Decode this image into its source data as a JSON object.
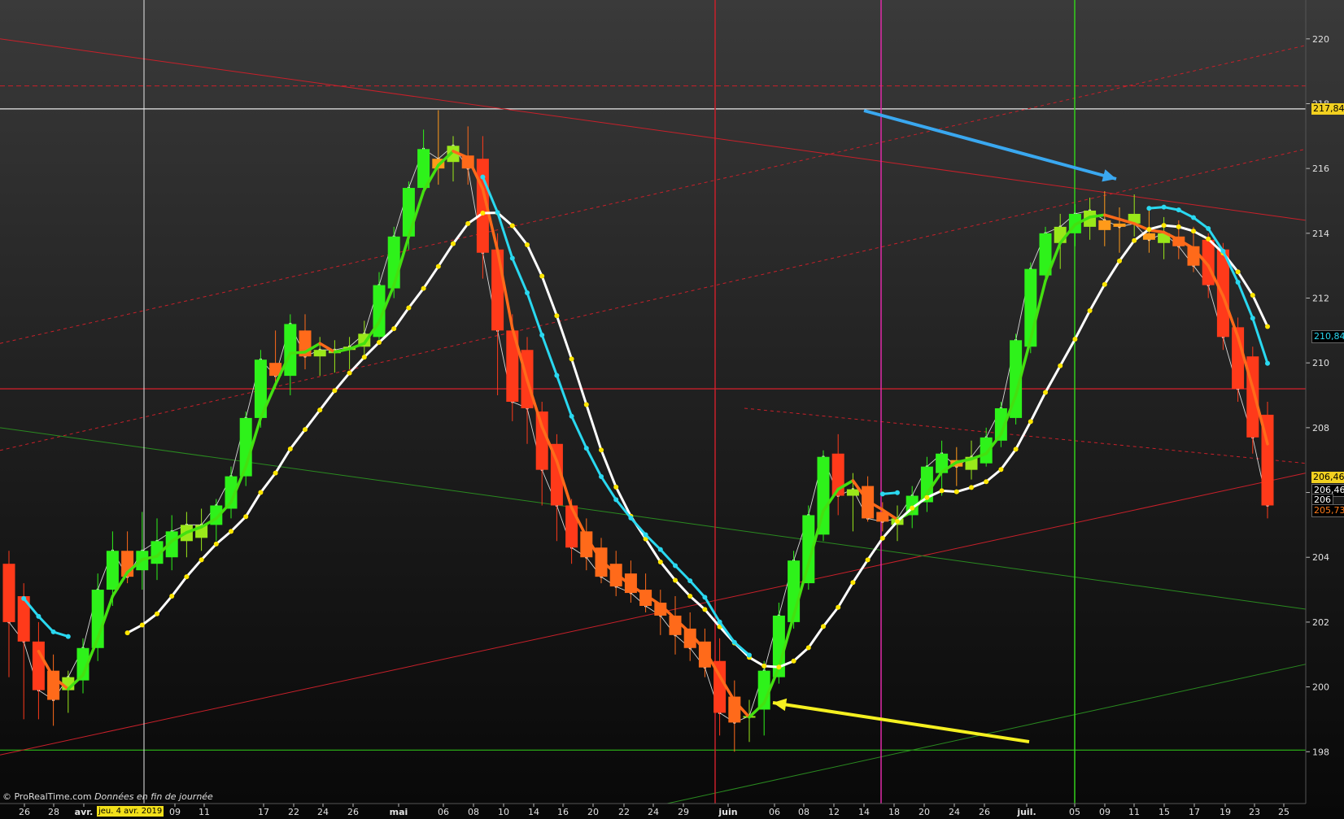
{
  "app": {
    "credit": "© ProRealTime.com",
    "credit_note": "Données en fin de journée",
    "cursor_date": "jeu. 4 avr. 2019"
  },
  "colors": {
    "bull": "#2ef21a",
    "bear": "#ff3a1a",
    "hull_line": "#44e010",
    "sma_line": "#ffffff",
    "sma_points": "#ffe600",
    "ema_line": "#2ad8f0",
    "close_line": "#d8d8d8",
    "cursor_line": "#e8e8e8",
    "red_line": "#c8202a",
    "magenta_line": "#e02aa8",
    "green_line": "#32d01a",
    "arrow_blue": "#3aa8f0",
    "arrow_yellow": "#f5f020"
  },
  "price_labels": [
    {
      "text": "217,84",
      "bg": "#f2d020",
      "fg": "#000000",
      "price": 217.84
    },
    {
      "text": "210,84",
      "bg": "#000000",
      "fg": "#2ad8f0",
      "price": 210.84
    },
    {
      "text": "206,46",
      "bg": "#f2d020",
      "fg": "#000000",
      "price": 206.46
    },
    {
      "text": "206,46",
      "bg": "#000000",
      "fg": "#ffffff",
      "price": 206.1
    },
    {
      "text": "206",
      "bg": "#000000",
      "fg": "#ffffff",
      "price": 205.78
    },
    {
      "text": "205,73",
      "bg": "#000000",
      "fg": "#ff7a1a",
      "price": 205.46
    }
  ],
  "chart_data": {
    "type": "candlestick",
    "y_range": [
      196.4,
      221.2
    ],
    "y_ticks": [
      "198",
      "200",
      "202",
      "204",
      "206",
      "208",
      "210",
      "212",
      "214",
      "216",
      "218",
      "220"
    ],
    "y_tick_values": [
      198,
      200,
      202,
      204,
      206,
      208,
      210,
      212,
      214,
      216,
      218,
      220
    ],
    "x_ticks": [
      "26",
      "28",
      "avr.",
      "jeu. 4 avr. 2019",
      "09",
      "11",
      "17",
      "22",
      "24",
      "26",
      "mai",
      "06",
      "08",
      "10",
      "14",
      "16",
      "20",
      "22",
      "24",
      "29",
      "juin",
      "06",
      "08",
      "12",
      "14",
      "18",
      "20",
      "24",
      "26",
      "juil.",
      "05",
      "09",
      "11",
      "15",
      "17",
      "19",
      "23",
      "25"
    ],
    "x_tick_bold": [
      false,
      false,
      true,
      false,
      false,
      false,
      false,
      false,
      false,
      false,
      true,
      false,
      false,
      false,
      false,
      false,
      false,
      false,
      false,
      false,
      true,
      false,
      false,
      false,
      false,
      false,
      false,
      false,
      false,
      true,
      false,
      false,
      false,
      false,
      false,
      false,
      false,
      false
    ],
    "candles": [
      [
        203.8,
        204.2,
        200.3,
        202.0
      ],
      [
        202.8,
        203.2,
        199.0,
        201.4
      ],
      [
        201.4,
        202.0,
        199.0,
        199.9
      ],
      [
        200.5,
        201.0,
        198.8,
        199.6
      ],
      [
        199.9,
        200.5,
        199.2,
        200.3
      ],
      [
        200.2,
        201.5,
        199.8,
        201.2
      ],
      [
        201.2,
        203.5,
        200.8,
        203.0
      ],
      [
        203.0,
        204.8,
        202.5,
        204.2
      ],
      [
        204.2,
        204.8,
        203.2,
        203.4
      ],
      [
        203.6,
        205.4,
        203.0,
        204.2
      ],
      [
        203.8,
        205.2,
        203.3,
        204.5
      ],
      [
        204.0,
        205.3,
        203.6,
        204.8
      ],
      [
        204.5,
        205.4,
        204.0,
        205.0
      ],
      [
        204.6,
        205.5,
        204.2,
        205.0
      ],
      [
        205.0,
        205.8,
        204.5,
        205.6
      ],
      [
        205.5,
        206.8,
        205.2,
        206.5
      ],
      [
        206.5,
        208.5,
        206.2,
        208.3
      ],
      [
        208.3,
        210.4,
        208.0,
        210.1
      ],
      [
        210.0,
        211.0,
        209.2,
        209.6
      ],
      [
        209.6,
        211.5,
        209.0,
        211.2
      ],
      [
        211.0,
        211.5,
        209.8,
        210.2
      ],
      [
        210.2,
        210.8,
        209.6,
        210.4
      ],
      [
        210.3,
        210.7,
        209.7,
        210.4
      ],
      [
        210.4,
        210.8,
        209.8,
        210.5
      ],
      [
        210.5,
        211.3,
        210.1,
        210.9
      ],
      [
        210.8,
        212.8,
        210.6,
        212.4
      ],
      [
        212.3,
        214.2,
        212.0,
        213.9
      ],
      [
        213.9,
        215.6,
        213.5,
        215.4
      ],
      [
        215.4,
        217.2,
        215.2,
        216.6
      ],
      [
        216.0,
        217.8,
        215.5,
        216.3
      ],
      [
        216.2,
        217.0,
        215.6,
        216.7
      ],
      [
        216.4,
        217.3,
        215.5,
        216.0
      ],
      [
        216.3,
        217.0,
        212.6,
        213.4
      ],
      [
        213.5,
        214.0,
        209.0,
        211.0
      ],
      [
        211.0,
        211.5,
        208.2,
        208.8
      ],
      [
        210.4,
        210.8,
        207.5,
        208.6
      ],
      [
        208.5,
        208.8,
        205.6,
        206.7
      ],
      [
        207.5,
        207.8,
        204.5,
        205.6
      ],
      [
        205.6,
        205.8,
        203.8,
        204.3
      ],
      [
        204.8,
        205.2,
        203.6,
        204.0
      ],
      [
        204.3,
        204.6,
        203.2,
        203.4
      ],
      [
        203.8,
        204.2,
        202.8,
        203.1
      ],
      [
        203.5,
        203.9,
        202.6,
        202.9
      ],
      [
        203.0,
        203.5,
        202.3,
        202.5
      ],
      [
        202.6,
        203.0,
        201.6,
        202.2
      ],
      [
        202.2,
        202.8,
        201.0,
        201.6
      ],
      [
        201.8,
        202.3,
        200.8,
        201.2
      ],
      [
        201.4,
        201.8,
        200.3,
        200.6
      ],
      [
        200.8,
        201.5,
        198.5,
        199.2
      ],
      [
        199.7,
        200.2,
        198.0,
        198.9
      ],
      [
        199.1,
        199.6,
        198.3,
        199.1
      ],
      [
        199.3,
        200.8,
        198.5,
        200.5
      ],
      [
        200.3,
        202.6,
        200.1,
        202.2
      ],
      [
        202.0,
        204.2,
        201.8,
        203.9
      ],
      [
        203.2,
        205.6,
        203.0,
        205.3
      ],
      [
        204.7,
        207.3,
        204.5,
        207.1
      ],
      [
        207.2,
        207.8,
        205.3,
        205.9
      ],
      [
        205.9,
        206.6,
        204.8,
        206.1
      ],
      [
        206.2,
        206.5,
        205.1,
        205.2
      ],
      [
        205.4,
        205.7,
        204.8,
        205.1
      ],
      [
        205.0,
        205.6,
        204.5,
        205.2
      ],
      [
        205.3,
        206.2,
        204.9,
        205.9
      ],
      [
        205.7,
        207.1,
        205.4,
        206.8
      ],
      [
        206.6,
        207.6,
        205.9,
        207.2
      ],
      [
        207.0,
        207.4,
        206.2,
        206.8
      ],
      [
        206.7,
        207.6,
        206.4,
        207.1
      ],
      [
        206.9,
        208.0,
        206.8,
        207.7
      ],
      [
        207.6,
        208.8,
        207.4,
        208.6
      ],
      [
        208.3,
        210.9,
        208.1,
        210.7
      ],
      [
        210.5,
        213.1,
        210.3,
        212.9
      ],
      [
        212.7,
        214.2,
        212.4,
        214.0
      ],
      [
        213.7,
        214.6,
        212.9,
        214.2
      ],
      [
        214.0,
        214.9,
        213.6,
        214.6
      ],
      [
        214.2,
        215.1,
        213.8,
        214.7
      ],
      [
        214.1,
        215.3,
        213.6,
        214.4
      ],
      [
        214.3,
        214.8,
        213.4,
        214.2
      ],
      [
        214.6,
        215.2,
        213.9,
        214.3
      ],
      [
        214.0,
        214.7,
        213.4,
        213.8
      ],
      [
        213.7,
        214.5,
        213.2,
        214.0
      ],
      [
        213.9,
        214.4,
        213.2,
        213.6
      ],
      [
        213.6,
        214.2,
        212.8,
        213.0
      ],
      [
        213.8,
        214.0,
        212.0,
        212.4
      ],
      [
        213.5,
        213.7,
        210.4,
        210.8
      ],
      [
        211.1,
        211.4,
        208.8,
        209.2
      ],
      [
        210.2,
        210.5,
        207.2,
        207.7
      ],
      [
        208.4,
        208.8,
        205.2,
        205.6
      ]
    ]
  }
}
